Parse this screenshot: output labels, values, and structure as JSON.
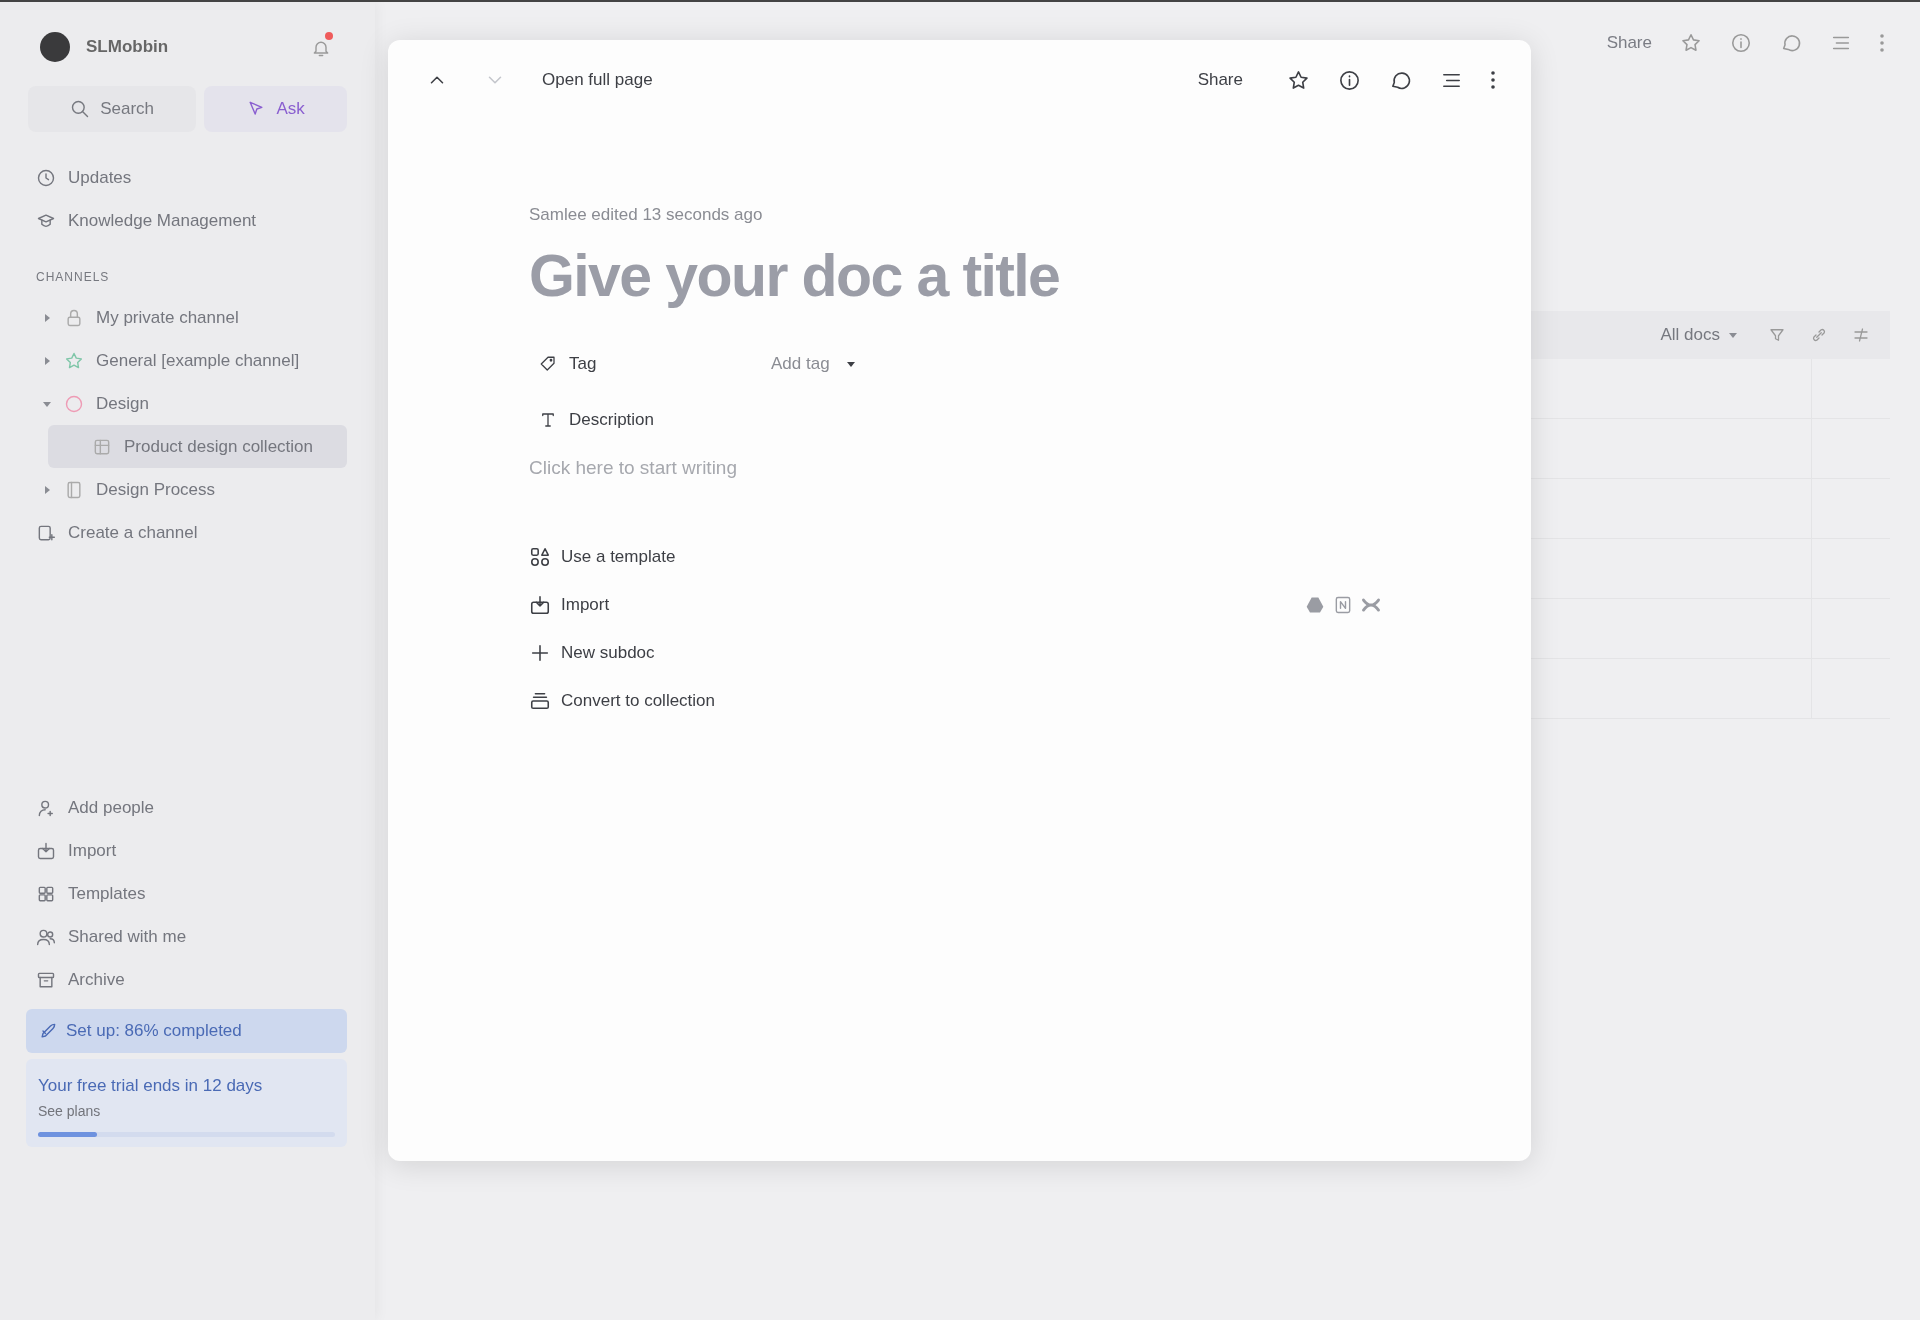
{
  "sidebar": {
    "workspace": {
      "name": "SLMobbin"
    },
    "notification": {
      "unread": true
    },
    "search": {
      "label": "Search"
    },
    "ask": {
      "label": "Ask"
    },
    "nav": [
      {
        "label": "Updates"
      },
      {
        "label": "Knowledge Management"
      }
    ],
    "section_title": "CHANNELS",
    "channels": [
      {
        "label": "My private channel",
        "expanded": false,
        "selected": false
      },
      {
        "label": "General [example channel]",
        "expanded": false,
        "selected": false
      },
      {
        "label": "Design",
        "expanded": true,
        "selected": false,
        "children": [
          {
            "label": "Product design collection",
            "selected": true
          }
        ]
      },
      {
        "label": "Design Process",
        "expanded": false,
        "selected": false
      }
    ],
    "create_channel": "Create a channel",
    "bottom_nav": [
      {
        "label": "Add people"
      },
      {
        "label": "Import"
      },
      {
        "label": "Templates"
      },
      {
        "label": "Shared with me"
      },
      {
        "label": "Archive"
      }
    ],
    "setup_banner": "Set up: 86% completed",
    "trial": {
      "title": "Your free trial ends in 12 days",
      "link": "See plans",
      "level": 0.2
    }
  },
  "page_toolbar": {
    "share": "Share"
  },
  "collection_toolbar": {
    "view": "All docs"
  },
  "modal": {
    "prev": {
      "disabled": false
    },
    "next": {
      "disabled": true
    },
    "open_full_page": "Open full page",
    "share": "Share",
    "meta": "Samlee edited 13 seconds ago",
    "title": {
      "placeholder": "Give your doc a title"
    },
    "properties": [
      {
        "label": "Tag",
        "value_placeholder": "Add tag"
      },
      {
        "label": "Description"
      }
    ],
    "body": {
      "placeholder": "Click here to start writing"
    },
    "actions": [
      {
        "label": "Use a template"
      },
      {
        "label": "Import"
      },
      {
        "label": "New subdoc"
      },
      {
        "label": "Convert to collection"
      }
    ]
  }
}
